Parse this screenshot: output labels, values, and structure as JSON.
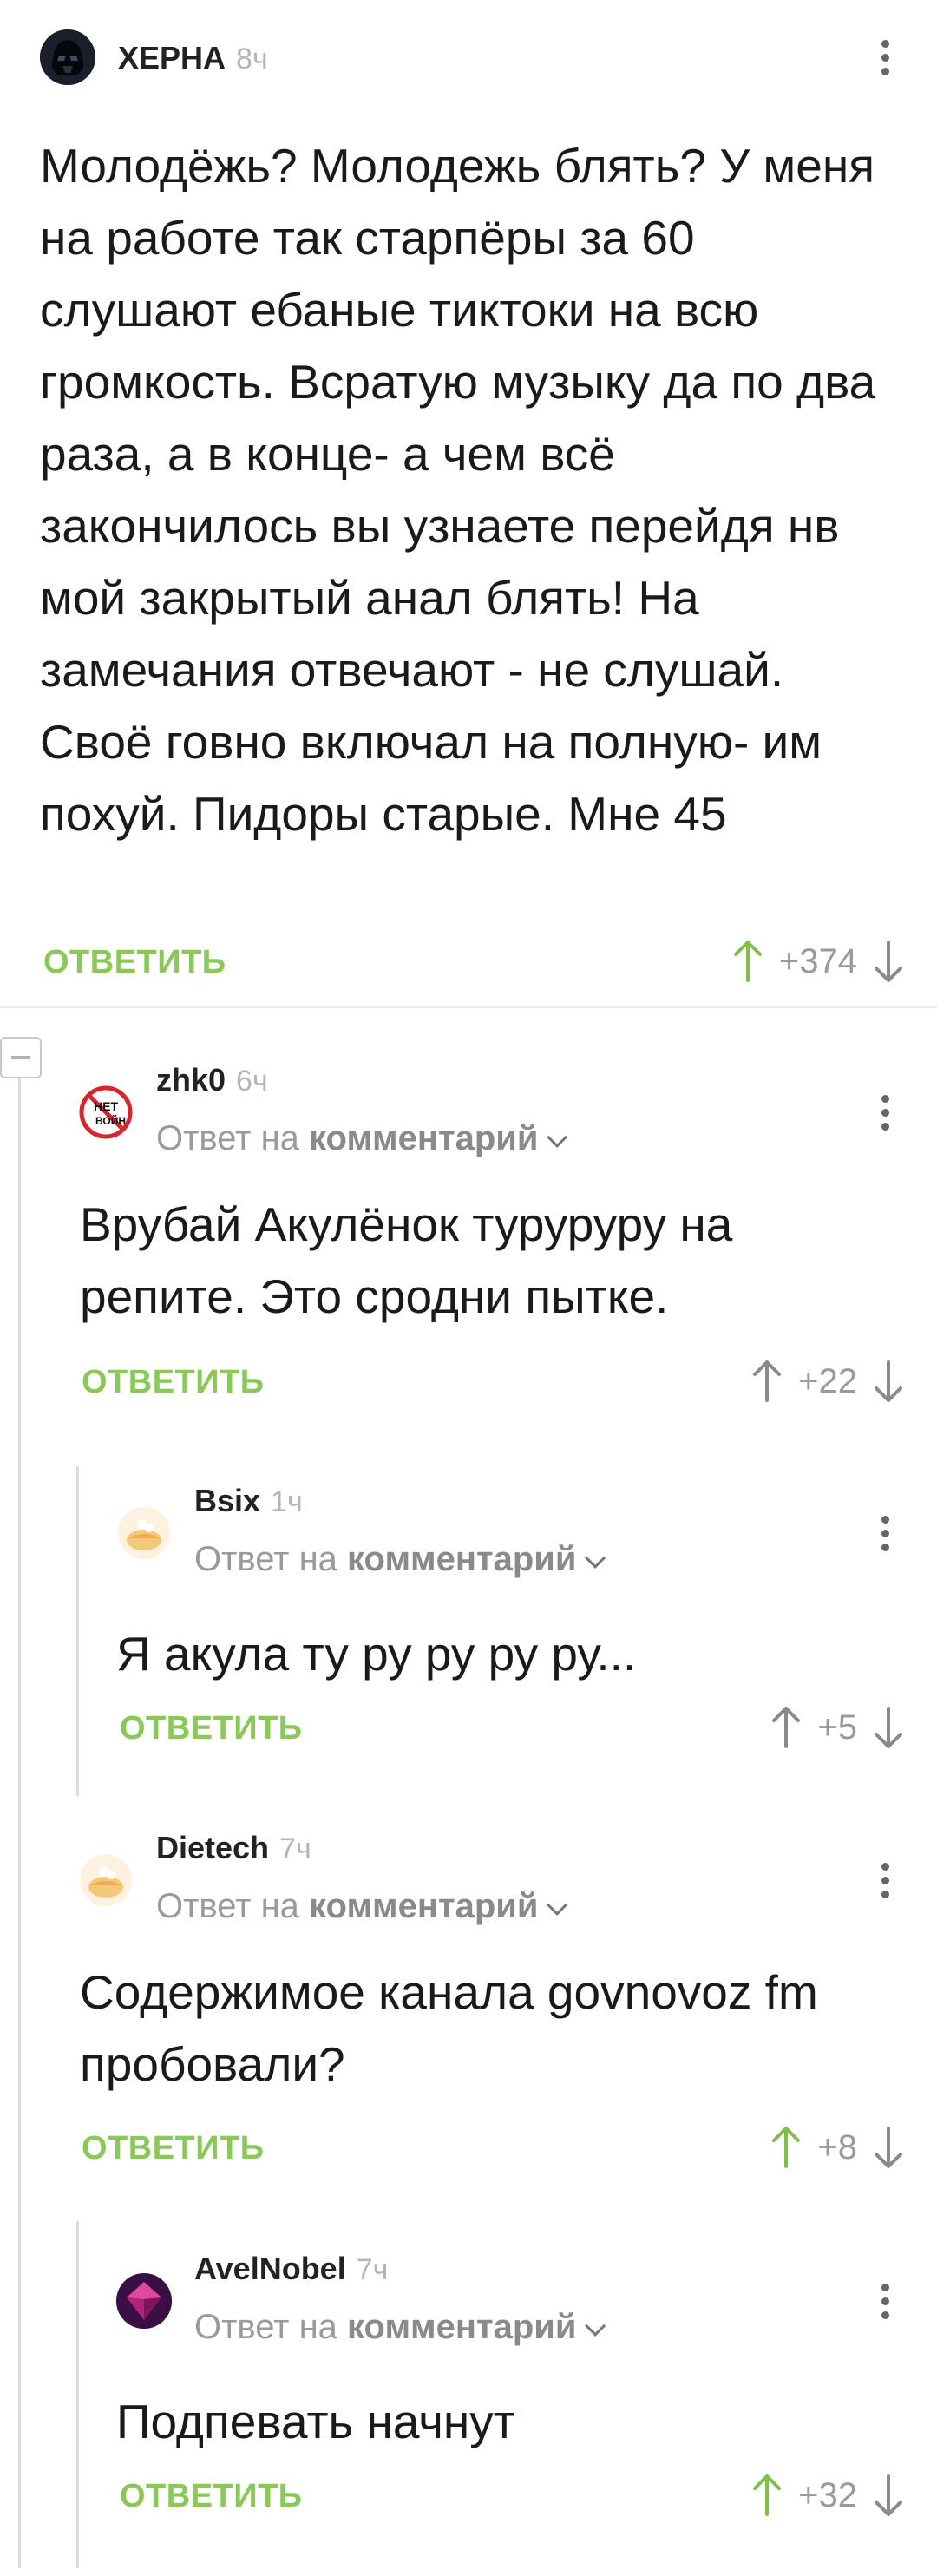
{
  "colors": {
    "reply_green": "#8ac858",
    "vote_green": "#7fc04a",
    "muted": "#9a9a9a"
  },
  "comments": [
    {
      "author": "ХЕРНА",
      "time": "8ч",
      "text": "Молодёжь? Молодежь блять? У меня на работе так старпёры за 60 слушают ебаные тиктоки на всю громкость. Всратую музыку да по два раза, а в конце- а чем всё закончилось вы узнаете перейдя нв мой закрытый анал блять! На замечания отвечают - не слушай. Своё говно включал на полную- им похуй. Пидоры старые. Мне 45",
      "reply_label": "ОТВЕТИТЬ",
      "votes": "+374",
      "avatar_icon": "darth-vader-avatar"
    },
    {
      "author": "zhk0",
      "time": "6ч",
      "reply_to_prefix": "Ответ на",
      "reply_to_target": "комментарий",
      "text": "Врубай Акулёнок туруруру на репите. Это сродни пытке.",
      "reply_label": "ОТВЕТИТЬ",
      "votes": "+22",
      "avatar_icon": "no-war-avatar"
    },
    {
      "author": "Bsix",
      "time": "1ч",
      "reply_to_prefix": "Ответ на",
      "reply_to_target": "комментарий",
      "text": "Я акула ту ру ру ру ру...",
      "reply_label": "ОТВЕТИТЬ",
      "votes": "+5",
      "avatar_icon": "default-cake-avatar"
    },
    {
      "author": "Dietech",
      "time": "7ч",
      "reply_to_prefix": "Ответ на",
      "reply_to_target": "комментарий",
      "text": "Содержимое канала govnovoz fm пробовали?",
      "reply_label": "ОТВЕТИТЬ",
      "votes": "+8",
      "avatar_icon": "default-cake-avatar"
    },
    {
      "author": "AvelNobel",
      "time": "7ч",
      "reply_to_prefix": "Ответ на",
      "reply_to_target": "комментарий",
      "text": "Подпевать начнут",
      "reply_label": "ОТВЕТИТЬ",
      "votes": "+32",
      "avatar_icon": "purple-gem-avatar"
    }
  ]
}
